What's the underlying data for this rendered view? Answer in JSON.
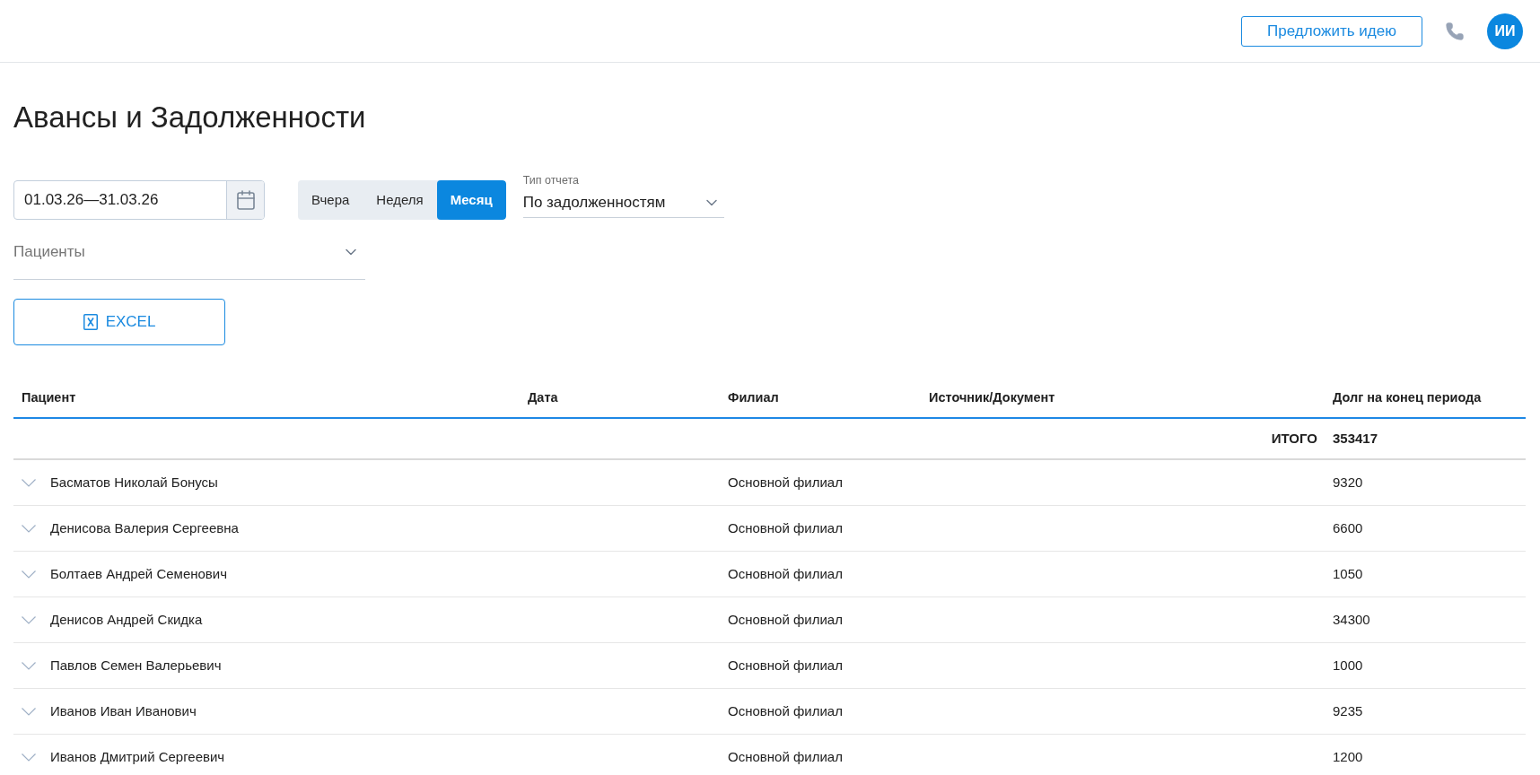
{
  "header": {
    "suggest_button": "Предложить идею",
    "avatar": "ИИ"
  },
  "title": "Авансы и Задолженности",
  "filters": {
    "date_range": {
      "value": "01.03.26—31.03.26"
    },
    "periods": [
      {
        "label": "Вчера",
        "selected": false
      },
      {
        "label": "Неделя",
        "selected": false
      },
      {
        "label": "Месяц",
        "selected": true
      }
    ],
    "report_type": {
      "label": "Тип отчета",
      "value": "По задолженностям"
    },
    "patients": {
      "placeholder": "Пациенты"
    },
    "excel_button": "EXCEL"
  },
  "table": {
    "columns": [
      "Пациент",
      "Дата",
      "Филиал",
      "Источник/Документ",
      "Долг на конец периода"
    ],
    "total": {
      "label": "ИТОГО",
      "value": "353417"
    },
    "rows": [
      {
        "patient": "Басматов Николай Бонусы",
        "branch": "Основной филиал",
        "debt": "9320",
        "expanded": false
      },
      {
        "patient": "Денисова Валерия Сергеевна",
        "branch": "Основной филиал",
        "debt": "6600",
        "expanded": false
      },
      {
        "patient": "Болтаев Андрей Семенович",
        "branch": "Основной филиал",
        "debt": "1050",
        "expanded": false
      },
      {
        "patient": "Денисов Андрей Скидка",
        "branch": "Основной филиал",
        "debt": "34300",
        "expanded": false
      },
      {
        "patient": "Павлов Семен Валерьевич",
        "branch": "Основной филиал",
        "debt": "1000",
        "expanded": false
      },
      {
        "patient": "Иванов Иван Иванович",
        "branch": "Основной филиал",
        "debt": "9235",
        "expanded": false
      },
      {
        "patient": "Иванов Дмитрий Сергеевич",
        "branch": "Основной филиал",
        "debt": "1200",
        "expanded": false
      }
    ]
  }
}
